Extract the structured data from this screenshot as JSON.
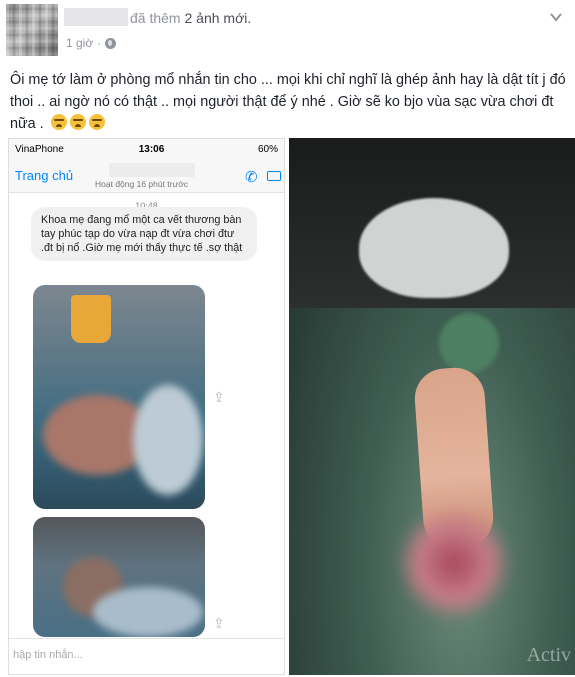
{
  "post": {
    "action_prefix": "đã thêm",
    "action_count": "2 ảnh mới.",
    "time": "1 giờ",
    "text": "Ôi mẹ tớ làm ở phòng mổ nhắn tin cho ... mọi khi chỉ nghĩ là ghép ảnh hay là dật tít j đó thoi .. ai ngờ nó có thật .. mọi người thật để ý nhé . Giờ sẽ ko bjo vùa sạc vừa chơi đt nữa ."
  },
  "phone": {
    "carrier": "VinaPhone",
    "time": "13:06",
    "battery": "60%",
    "back_label": "Trang chủ",
    "active_status": "Hoạt động 16 phút trước",
    "chat_time": "10:48",
    "message": "Khoa mẹ đang mổ một ca vết thương bàn tay phúc tạp do vừa nạp đt vừa chơi đtư .đt bị nổ .Giờ mẹ mới thấy thực tế .sợ thật",
    "input_placeholder": "hập tin nhắn..."
  },
  "photo_right": {
    "watermark": "Activ"
  },
  "icons": {
    "privacy": "globe-icon",
    "menu": "chevron-down-icon",
    "emoji": "crying-face-icon"
  },
  "colors": {
    "link_blue": "#0084ff",
    "meta_gray": "#90949c"
  }
}
